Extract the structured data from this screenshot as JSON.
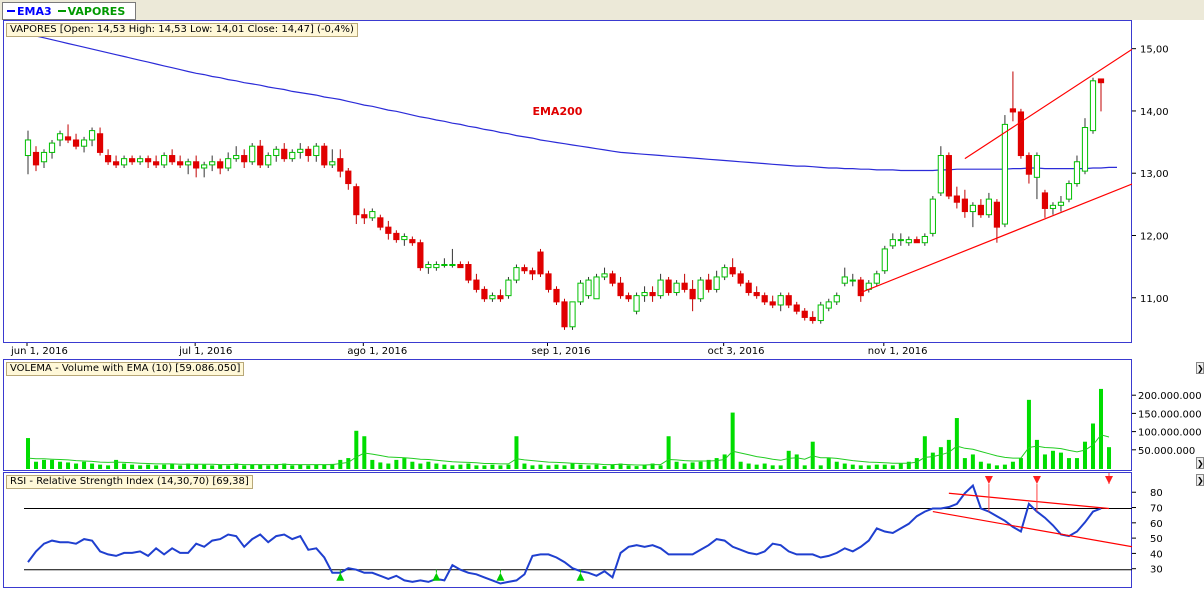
{
  "tabs": [
    {
      "label": "EMA3",
      "color": "#0000ff"
    },
    {
      "label": "VAPORES",
      "color": "#009900"
    }
  ],
  "colors": {
    "up": "#00c000",
    "down": "#e00000",
    "ema": "#2b2bd8",
    "trend": "#ff0000",
    "volume": "#00dd00",
    "volume_ema": "#22cc22",
    "rsi": "#1f3fcf",
    "panel_border": "#3a3ad0",
    "signal_buy": "#00cc00",
    "signal_sell": "#ff2020"
  },
  "price_panel": {
    "label": "VAPORES [Open: 14,53  High: 14,53  Low: 14,01  Close: 14,47] (-0,4%)",
    "annotation": "EMA200",
    "y_ticks": [
      "15,00",
      "14,00",
      "13,00",
      "12,00",
      "11,00"
    ],
    "x_ticks": [
      "jun 1, 2016",
      "jul 1, 2016",
      "ago 1, 2016",
      "sep 1, 2016",
      "oct 3, 2016",
      "nov 1, 2016"
    ]
  },
  "volume_panel": {
    "label": "VOLEMA - Volume with EMA (10) [59.086.050]",
    "y_ticks": [
      "200.000.000",
      "150.000.000",
      "100.000.000",
      "50.000.000"
    ]
  },
  "rsi_panel": {
    "label": "RSI - Relative Strength Index (14,30,70) [69,38]",
    "y_ticks": [
      "80",
      "70",
      "60",
      "50",
      "40",
      "30"
    ]
  },
  "chart_data": {
    "type": "candlestick",
    "y_range": [
      10.45,
      15.3
    ],
    "levels": [
      15.0,
      14.0,
      13.0,
      12.0,
      11.0
    ],
    "ohlc": [
      [
        13.3,
        13.7,
        13.0,
        13.55
      ],
      [
        13.35,
        13.45,
        13.05,
        13.15
      ],
      [
        13.2,
        13.4,
        13.1,
        13.35
      ],
      [
        13.35,
        13.55,
        13.25,
        13.5
      ],
      [
        13.55,
        13.7,
        13.45,
        13.65
      ],
      [
        13.6,
        13.8,
        13.5,
        13.55
      ],
      [
        13.55,
        13.65,
        13.4,
        13.45
      ],
      [
        13.45,
        13.6,
        13.35,
        13.55
      ],
      [
        13.55,
        13.75,
        13.45,
        13.7
      ],
      [
        13.65,
        13.75,
        13.3,
        13.35
      ],
      [
        13.3,
        13.4,
        13.15,
        13.2
      ],
      [
        13.2,
        13.3,
        13.1,
        13.15
      ],
      [
        13.15,
        13.3,
        13.1,
        13.25
      ],
      [
        13.25,
        13.3,
        13.15,
        13.2
      ],
      [
        13.2,
        13.3,
        13.15,
        13.25
      ],
      [
        13.25,
        13.3,
        13.1,
        13.2
      ],
      [
        13.2,
        13.3,
        13.1,
        13.15
      ],
      [
        13.15,
        13.35,
        13.1,
        13.3
      ],
      [
        13.3,
        13.4,
        13.15,
        13.2
      ],
      [
        13.2,
        13.3,
        13.1,
        13.15
      ],
      [
        13.15,
        13.25,
        13.0,
        13.2
      ],
      [
        13.2,
        13.3,
        12.95,
        13.1
      ],
      [
        13.1,
        13.2,
        12.95,
        13.15
      ],
      [
        13.15,
        13.3,
        13.05,
        13.2
      ],
      [
        13.2,
        13.25,
        13.0,
        13.1
      ],
      [
        13.1,
        13.35,
        13.05,
        13.25
      ],
      [
        13.25,
        13.45,
        13.2,
        13.3
      ],
      [
        13.3,
        13.4,
        13.1,
        13.2
      ],
      [
        13.2,
        13.5,
        13.15,
        13.45
      ],
      [
        13.45,
        13.55,
        13.1,
        13.15
      ],
      [
        13.15,
        13.35,
        13.1,
        13.3
      ],
      [
        13.3,
        13.45,
        13.2,
        13.4
      ],
      [
        13.4,
        13.5,
        13.2,
        13.25
      ],
      [
        13.25,
        13.4,
        13.2,
        13.35
      ],
      [
        13.35,
        13.5,
        13.25,
        13.4
      ],
      [
        13.4,
        13.45,
        13.2,
        13.3
      ],
      [
        13.3,
        13.5,
        13.2,
        13.45
      ],
      [
        13.45,
        13.5,
        13.1,
        13.15
      ],
      [
        13.15,
        13.4,
        13.1,
        13.2
      ],
      [
        13.25,
        13.4,
        12.95,
        13.05
      ],
      [
        13.05,
        13.1,
        12.75,
        12.85
      ],
      [
        12.8,
        12.85,
        12.2,
        12.35
      ],
      [
        12.35,
        12.45,
        12.2,
        12.3
      ],
      [
        12.3,
        12.45,
        12.25,
        12.4
      ],
      [
        12.3,
        12.35,
        12.1,
        12.15
      ],
      [
        12.15,
        12.25,
        11.95,
        12.05
      ],
      [
        12.05,
        12.1,
        11.9,
        11.95
      ],
      [
        11.95,
        12.05,
        11.85,
        12.0
      ],
      [
        11.95,
        12.0,
        11.85,
        11.9
      ],
      [
        11.9,
        11.95,
        11.45,
        11.5
      ],
      [
        11.5,
        11.6,
        11.4,
        11.55
      ],
      [
        11.5,
        11.6,
        11.45,
        11.55
      ],
      [
        11.55,
        11.65,
        11.5,
        11.55
      ],
      [
        11.55,
        11.8,
        11.5,
        11.55
      ],
      [
        11.55,
        11.6,
        11.5,
        11.5
      ],
      [
        11.55,
        11.6,
        11.25,
        11.3
      ],
      [
        11.3,
        11.4,
        11.1,
        11.15
      ],
      [
        11.15,
        11.2,
        10.95,
        11.0
      ],
      [
        11.0,
        11.1,
        10.95,
        11.05
      ],
      [
        11.05,
        11.15,
        10.95,
        11.0
      ],
      [
        11.05,
        11.35,
        11.0,
        11.3
      ],
      [
        11.3,
        11.55,
        11.25,
        11.5
      ],
      [
        11.5,
        11.55,
        11.4,
        11.45
      ],
      [
        11.45,
        11.5,
        11.3,
        11.4
      ],
      [
        11.75,
        11.8,
        11.35,
        11.4
      ],
      [
        11.4,
        11.45,
        11.1,
        11.15
      ],
      [
        11.15,
        11.2,
        10.9,
        10.95
      ],
      [
        10.95,
        11.0,
        10.5,
        10.55
      ],
      [
        10.55,
        10.95,
        10.5,
        10.95
      ],
      [
        10.95,
        11.3,
        10.9,
        11.25
      ],
      [
        11.05,
        11.35,
        11.0,
        11.3
      ],
      [
        11.0,
        11.4,
        11.0,
        11.35
      ],
      [
        11.35,
        11.5,
        11.3,
        11.4
      ],
      [
        11.4,
        11.45,
        11.2,
        11.25
      ],
      [
        11.25,
        11.35,
        11.0,
        11.05
      ],
      [
        11.05,
        11.1,
        10.95,
        11.0
      ],
      [
        10.8,
        11.1,
        10.75,
        11.05
      ],
      [
        11.05,
        11.2,
        10.95,
        11.1
      ],
      [
        11.1,
        11.2,
        10.95,
        11.05
      ],
      [
        11.05,
        11.4,
        11.0,
        11.3
      ],
      [
        11.3,
        11.35,
        11.05,
        11.1
      ],
      [
        11.1,
        11.3,
        11.05,
        11.25
      ],
      [
        11.25,
        11.4,
        11.1,
        11.15
      ],
      [
        11.15,
        11.3,
        10.8,
        11.0
      ],
      [
        11.0,
        11.35,
        10.95,
        11.3
      ],
      [
        11.3,
        11.4,
        11.1,
        11.15
      ],
      [
        11.15,
        11.45,
        11.1,
        11.35
      ],
      [
        11.35,
        11.55,
        11.3,
        11.5
      ],
      [
        11.5,
        11.65,
        11.35,
        11.4
      ],
      [
        11.4,
        11.45,
        11.2,
        11.25
      ],
      [
        11.25,
        11.3,
        11.05,
        11.1
      ],
      [
        11.1,
        11.2,
        11.0,
        11.05
      ],
      [
        11.05,
        11.1,
        10.9,
        10.95
      ],
      [
        10.95,
        11.05,
        10.85,
        10.9
      ],
      [
        10.9,
        11.1,
        10.8,
        11.05
      ],
      [
        11.05,
        11.1,
        10.85,
        10.9
      ],
      [
        10.9,
        10.95,
        10.75,
        10.8
      ],
      [
        10.8,
        10.85,
        10.65,
        10.7
      ],
      [
        10.7,
        10.8,
        10.6,
        10.65
      ],
      [
        10.65,
        10.95,
        10.6,
        10.9
      ],
      [
        10.85,
        11.0,
        10.8,
        10.95
      ],
      [
        10.95,
        11.1,
        10.9,
        11.05
      ],
      [
        11.25,
        11.5,
        11.2,
        11.35
      ],
      [
        11.3,
        11.4,
        11.2,
        11.3
      ],
      [
        11.3,
        11.35,
        10.95,
        11.05
      ],
      [
        11.15,
        11.3,
        11.1,
        11.25
      ],
      [
        11.25,
        11.45,
        11.2,
        11.4
      ],
      [
        11.45,
        11.85,
        11.4,
        11.8
      ],
      [
        11.85,
        12.05,
        11.8,
        11.95
      ],
      [
        11.95,
        12.05,
        11.85,
        11.95
      ],
      [
        11.9,
        12.0,
        11.85,
        11.95
      ],
      [
        11.95,
        12.0,
        11.9,
        11.9
      ],
      [
        11.9,
        12.05,
        11.85,
        12.0
      ],
      [
        12.05,
        12.65,
        12.0,
        12.6
      ],
      [
        12.7,
        13.45,
        12.65,
        13.3
      ],
      [
        13.3,
        13.35,
        12.6,
        12.65
      ],
      [
        12.65,
        12.8,
        12.45,
        12.55
      ],
      [
        12.6,
        12.75,
        12.3,
        12.4
      ],
      [
        12.4,
        12.55,
        12.15,
        12.5
      ],
      [
        12.5,
        12.6,
        12.3,
        12.35
      ],
      [
        12.35,
        12.7,
        12.3,
        12.6
      ],
      [
        12.55,
        12.6,
        11.9,
        12.15
      ],
      [
        12.2,
        13.95,
        12.15,
        13.8
      ],
      [
        14.05,
        14.65,
        13.85,
        14.0
      ],
      [
        14.0,
        14.05,
        13.25,
        13.3
      ],
      [
        13.3,
        13.35,
        12.85,
        13.0
      ],
      [
        12.95,
        13.35,
        12.6,
        13.3
      ],
      [
        12.7,
        12.75,
        12.3,
        12.45
      ],
      [
        12.45,
        12.55,
        12.35,
        12.5
      ],
      [
        12.5,
        12.65,
        12.4,
        12.55
      ],
      [
        12.6,
        12.9,
        12.55,
        12.85
      ],
      [
        12.85,
        13.3,
        12.8,
        13.2
      ],
      [
        13.05,
        13.9,
        13.0,
        13.75
      ],
      [
        13.7,
        14.55,
        13.65,
        14.5
      ],
      [
        14.53,
        14.53,
        14.01,
        14.47
      ]
    ],
    "ema200": [
      15.25,
      15.22,
      15.19,
      15.16,
      15.13,
      15.1,
      15.07,
      15.04,
      15.01,
      14.98,
      14.95,
      14.92,
      14.89,
      14.86,
      14.83,
      14.8,
      14.77,
      14.74,
      14.71,
      14.68,
      14.65,
      14.62,
      14.6,
      14.57,
      14.55,
      14.52,
      14.5,
      14.47,
      14.45,
      14.43,
      14.4,
      14.38,
      14.36,
      14.33,
      14.31,
      14.29,
      14.27,
      14.24,
      14.22,
      14.2,
      14.17,
      14.14,
      14.11,
      14.09,
      14.06,
      14.03,
      14.01,
      13.98,
      13.95,
      13.92,
      13.9,
      13.87,
      13.85,
      13.82,
      13.8,
      13.77,
      13.75,
      13.72,
      13.7,
      13.67,
      13.65,
      13.62,
      13.6,
      13.58,
      13.55,
      13.53,
      13.51,
      13.49,
      13.47,
      13.45,
      13.43,
      13.41,
      13.39,
      13.37,
      13.35,
      13.34,
      13.33,
      13.32,
      13.31,
      13.3,
      13.29,
      13.28,
      13.27,
      13.26,
      13.25,
      13.24,
      13.23,
      13.22,
      13.21,
      13.2,
      13.19,
      13.18,
      13.17,
      13.16,
      13.15,
      13.14,
      13.13,
      13.13,
      13.12,
      13.11,
      13.1,
      13.1,
      13.09,
      13.09,
      13.08,
      13.08,
      13.07,
      13.07,
      13.07,
      13.06,
      13.06,
      13.06,
      13.06,
      13.06,
      13.07,
      13.07,
      13.08,
      13.08,
      13.08,
      13.08,
      13.08,
      13.08,
      13.08,
      13.09,
      13.09,
      13.1,
      13.1,
      13.09,
      13.09,
      13.09,
      13.09,
      13.09,
      13.09,
      13.1,
      13.1,
      13.11,
      13.11
    ],
    "trend_lines_price": [
      {
        "i1": 117,
        "v1": 13.25,
        "i2": 139,
        "v2": 15.1
      },
      {
        "i1": 104,
        "v1": 11.1,
        "i2": 139,
        "v2": 12.9
      }
    ],
    "volume": [
      85,
      20,
      25,
      25,
      20,
      18,
      15,
      20,
      15,
      12,
      10,
      25,
      15,
      12,
      10,
      12,
      10,
      12,
      14,
      10,
      15,
      12,
      12,
      10,
      12,
      10,
      15,
      10,
      12,
      12,
      10,
      12,
      15,
      10,
      12,
      10,
      12,
      12,
      14,
      25,
      30,
      105,
      90,
      25,
      18,
      15,
      25,
      30,
      20,
      15,
      20,
      15,
      12,
      10,
      12,
      15,
      10,
      10,
      12,
      10,
      12,
      90,
      15,
      10,
      12,
      10,
      12,
      10,
      15,
      12,
      10,
      12,
      8,
      12,
      15,
      10,
      8,
      12,
      15,
      10,
      90,
      20,
      15,
      18,
      20,
      25,
      30,
      40,
      155,
      20,
      15,
      12,
      15,
      10,
      10,
      50,
      40,
      10,
      75,
      10,
      30,
      20,
      15,
      12,
      10,
      10,
      12,
      12,
      10,
      15,
      20,
      30,
      90,
      45,
      60,
      80,
      140,
      30,
      40,
      20,
      15,
      10,
      12,
      20,
      30,
      190,
      80,
      40,
      50,
      45,
      30,
      30,
      75,
      125,
      220,
      60
    ],
    "volume_ema": [
      30,
      28,
      28,
      27,
      26,
      25,
      23,
      22,
      21,
      19,
      18,
      19,
      18,
      17,
      16,
      15,
      14,
      14,
      14,
      13,
      13,
      13,
      13,
      13,
      12,
      12,
      13,
      12,
      12,
      12,
      12,
      12,
      13,
      12,
      12,
      12,
      12,
      12,
      12,
      15,
      18,
      33,
      44,
      41,
      37,
      33,
      32,
      31,
      29,
      27,
      26,
      24,
      22,
      20,
      19,
      18,
      17,
      15,
      15,
      14,
      14,
      28,
      25,
      23,
      21,
      19,
      18,
      17,
      16,
      15,
      14,
      14,
      12,
      12,
      13,
      12,
      11,
      11,
      12,
      12,
      26,
      25,
      23,
      22,
      22,
      22,
      23,
      26,
      49,
      44,
      39,
      34,
      31,
      27,
      24,
      29,
      31,
      27,
      36,
      31,
      31,
      29,
      26,
      23,
      21,
      19,
      18,
      17,
      16,
      16,
      16,
      19,
      32,
      34,
      39,
      46,
      63,
      57,
      54,
      48,
      42,
      36,
      32,
      30,
      30,
      59,
      63,
      59,
      58,
      56,
      51,
      47,
      52,
      66,
      94,
      88
    ],
    "rsi": [
      35,
      42,
      47,
      49,
      48,
      48,
      47,
      50,
      49,
      42,
      40,
      39,
      41,
      41,
      42,
      39,
      44,
      40,
      44,
      41,
      41,
      47,
      45,
      49,
      50,
      53,
      52,
      45,
      50,
      53,
      48,
      52,
      53,
      50,
      52,
      43,
      44,
      38,
      28,
      28,
      31,
      30,
      28,
      28,
      26,
      24,
      26,
      23,
      22,
      23,
      22,
      24,
      23,
      33,
      30,
      28,
      27,
      25,
      23,
      21,
      22,
      23,
      27,
      39,
      40,
      40,
      38,
      35,
      31,
      29,
      28,
      26,
      29,
      25,
      41,
      45,
      46,
      45,
      46,
      44,
      40,
      40,
      40,
      40,
      43,
      46,
      50,
      49,
      45,
      43,
      41,
      40,
      42,
      47,
      46,
      42,
      40,
      40,
      40,
      38,
      39,
      41,
      44,
      42,
      45,
      49,
      57,
      55,
      54,
      57,
      60,
      65,
      68,
      70,
      70,
      71,
      73,
      80,
      85,
      70,
      68,
      65,
      62,
      58,
      55,
      73,
      68,
      64,
      59,
      53,
      52,
      55,
      61,
      68,
      70
    ],
    "rsi_levels": [
      70,
      30
    ],
    "rsi_range": [
      20,
      88
    ],
    "rsi_trend_lines": [
      {
        "i1": 115,
        "v1": 80,
        "i2": 135,
        "v2": 70
      },
      {
        "i1": 113,
        "v1": 68,
        "i2": 139,
        "v2": 44
      }
    ],
    "signals_buy": [
      39,
      51,
      59,
      69
    ],
    "signals_sell": [
      120,
      126,
      135
    ]
  }
}
